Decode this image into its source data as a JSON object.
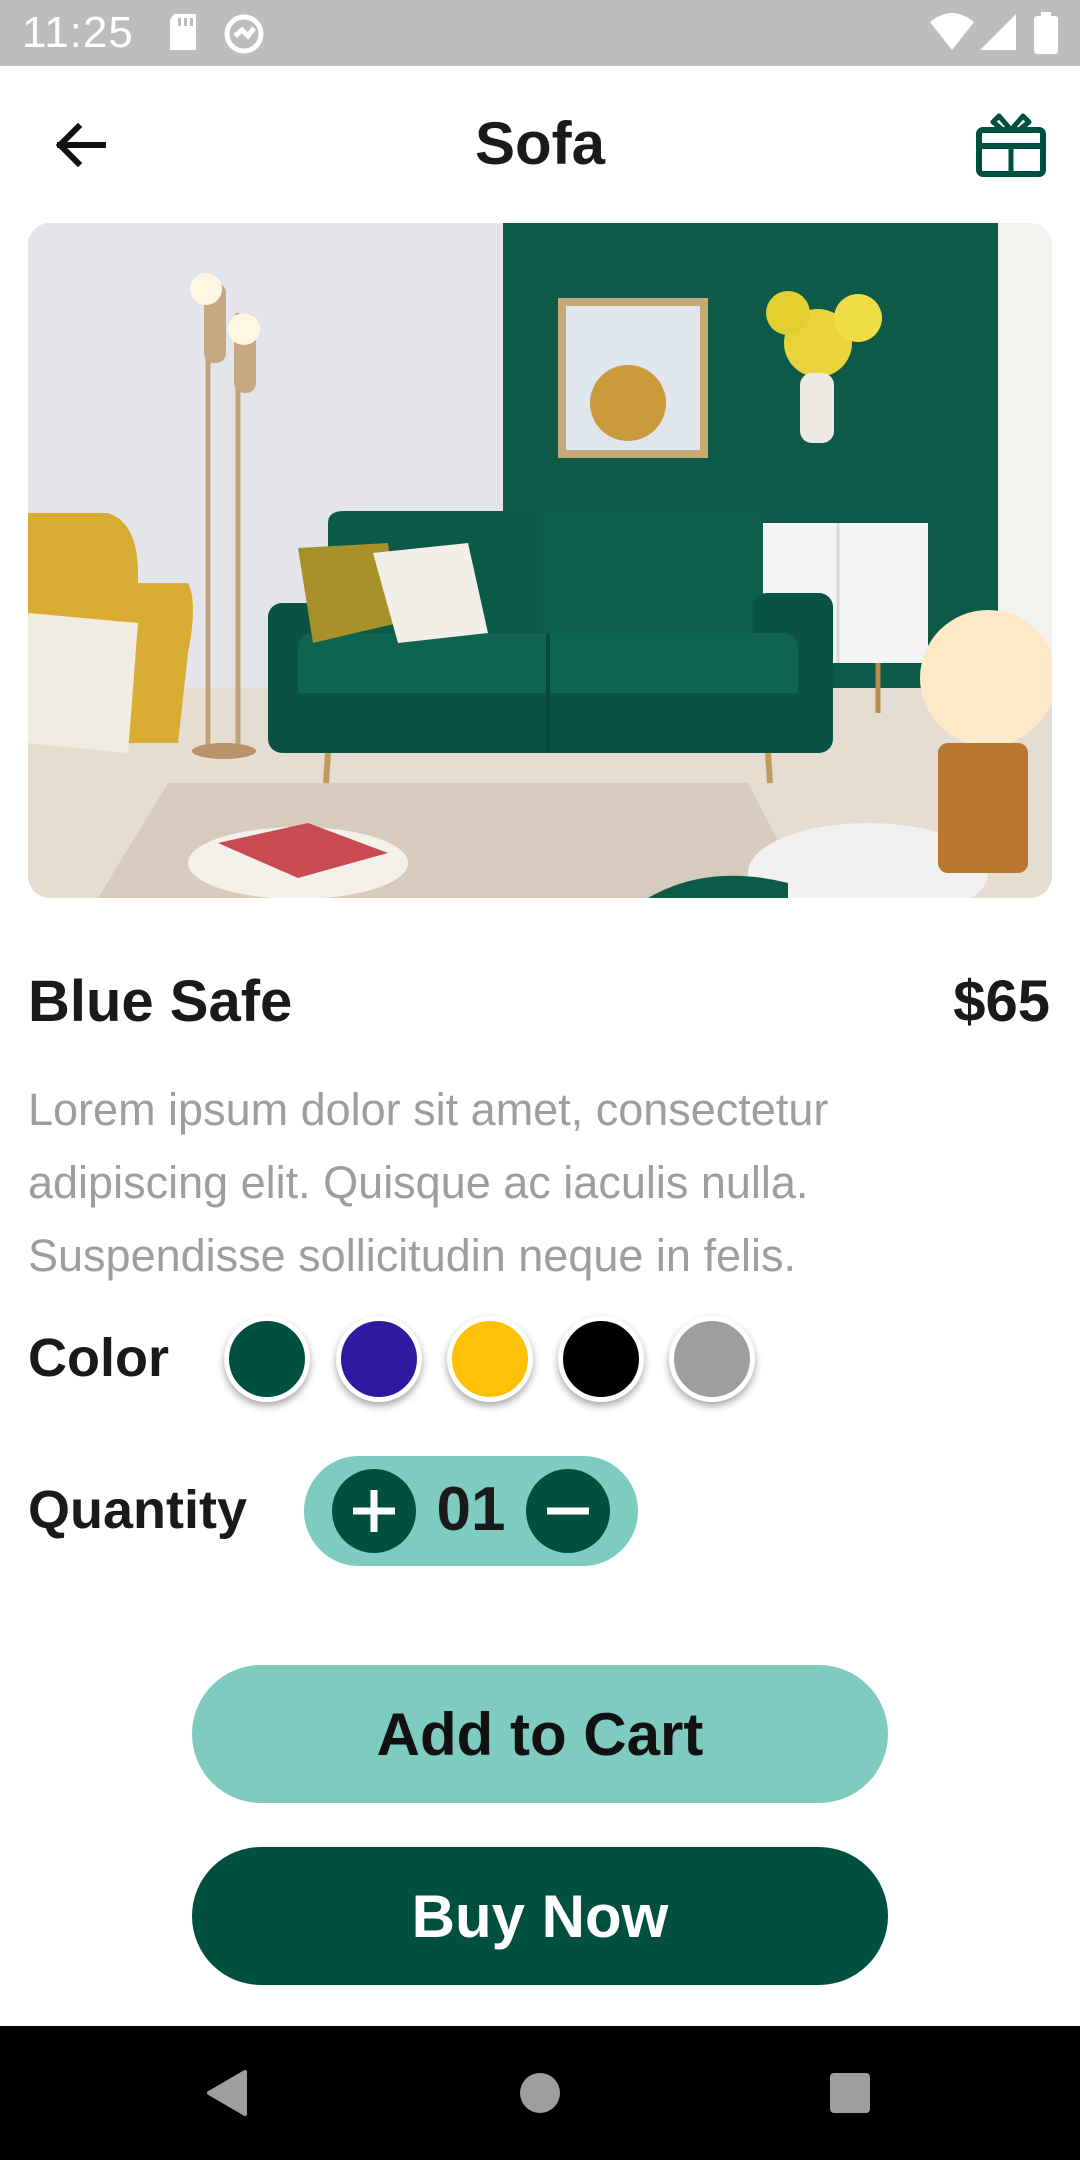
{
  "status_bar": {
    "time": "11:25",
    "icons": [
      "sd-card-icon",
      "sync-icon",
      "wifi-icon",
      "signal-icon",
      "battery-icon"
    ]
  },
  "app_bar": {
    "title": "Sofa",
    "back_icon": "arrow-back-icon",
    "action_icon": "gift-box-icon"
  },
  "product": {
    "image": "living-room-green-sofa-photo",
    "name": "Blue Safe",
    "price": "$65",
    "description": "Lorem ipsum dolor sit amet, consectetur adipiscing elit. Quisque ac iaculis nulla. Suspendisse sollicitudin neque in felis."
  },
  "color": {
    "label": "Color",
    "options": [
      "#00503f",
      "#2e1aa0",
      "#ffc107",
      "#000000",
      "#9e9e9e"
    ]
  },
  "quantity": {
    "label": "Quantity",
    "value": "01",
    "plus_icon": "plus-icon",
    "minus_icon": "minus-icon"
  },
  "actions": {
    "add_to_cart": "Add to Cart",
    "buy_now": "Buy Now"
  },
  "theme": {
    "primary": "#00503f",
    "accent": "#80cbc0"
  },
  "nav_bar": {
    "icons": [
      "back-triangle-icon",
      "home-circle-icon",
      "recents-square-icon"
    ]
  }
}
